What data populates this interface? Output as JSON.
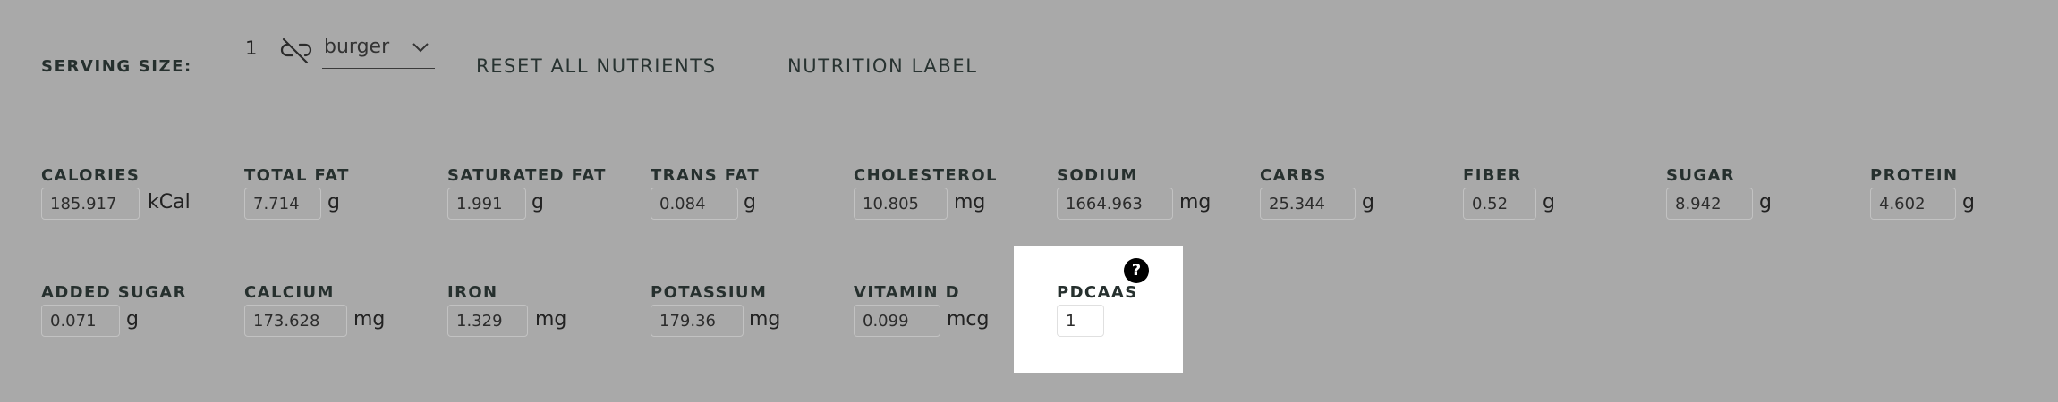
{
  "serving": {
    "label": "SERVING SIZE:",
    "quantity": "1",
    "unit": "burger",
    "link_icon": "unlink-icon",
    "dropdown_icon": "chevron-down-icon"
  },
  "actions": {
    "reset": "RESET ALL NUTRIENTS",
    "nutrition_label": "NUTRITION LABEL"
  },
  "nutrients": {
    "calories": {
      "label": "CALORIES",
      "value": "185.917",
      "unit": "kCal"
    },
    "total_fat": {
      "label": "TOTAL FAT",
      "value": "7.714",
      "unit": "g"
    },
    "saturated_fat": {
      "label": "SATURATED FAT",
      "value": "1.991",
      "unit": "g"
    },
    "trans_fat": {
      "label": "TRANS FAT",
      "value": "0.084",
      "unit": "g"
    },
    "cholesterol": {
      "label": "CHOLESTEROL",
      "value": "10.805",
      "unit": "mg"
    },
    "sodium": {
      "label": "SODIUM",
      "value": "1664.963",
      "unit": "mg"
    },
    "carbs": {
      "label": "CARBS",
      "value": "25.344",
      "unit": "g"
    },
    "fiber": {
      "label": "FIBER",
      "value": "0.52",
      "unit": "g"
    },
    "sugar": {
      "label": "SUGAR",
      "value": "8.942",
      "unit": "g"
    },
    "protein": {
      "label": "PROTEIN",
      "value": "4.602",
      "unit": "g"
    },
    "added_sugar": {
      "label": "ADDED SUGAR",
      "value": "0.071",
      "unit": "g"
    },
    "calcium": {
      "label": "CALCIUM",
      "value": "173.628",
      "unit": "mg"
    },
    "iron": {
      "label": "IRON",
      "value": "1.329",
      "unit": "mg"
    },
    "potassium": {
      "label": "POTASSIUM",
      "value": "179.36",
      "unit": "mg"
    },
    "vitamin_d": {
      "label": "VITAMIN D",
      "value": "0.099",
      "unit": "mcg"
    },
    "pdcaas": {
      "label": "PDCAAS",
      "value": "1",
      "help": "?"
    }
  },
  "colors": {
    "background": "#a9a9a9",
    "highlight_panel": "#ffffff",
    "text": "#26302e"
  }
}
